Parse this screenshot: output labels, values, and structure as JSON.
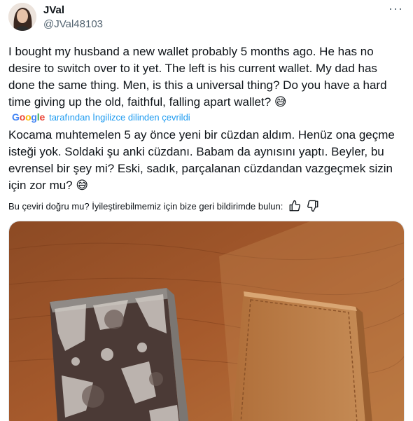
{
  "author": {
    "display_name": "JVal",
    "handle": "@JVal48103"
  },
  "icons": {
    "more": "more-horizontal-icon",
    "thumbs_up": "thumbs-up-icon",
    "thumbs_down": "thumbs-down-icon"
  },
  "more_glyph": "···",
  "tweet": {
    "text": "I bought my husband a new wallet probably 5 months ago. He has no\ndesire to switch over to it yet. The left is his current wallet. My dad has\ndone the same thing. Men, is this a universal thing? Do you have a hard\ntime giving up the old, faithful, falling apart wallet? 😅",
    "translated_by": "tarafından İngilizce dilinden çevrildi",
    "google_logo": [
      "G",
      "o",
      "o",
      "g",
      "l",
      "e"
    ],
    "translation": "Kocama muhtemelen 5 ay önce yeni bir cüzdan aldım. Henüz ona geçme\nisteği yok. Soldaki şu anki cüzdanı. Babam da aynısını yaptı. Beyler, bu\nevrensel bir şey mi? Eski, sadık, parçalanan cüzdandan vazgeçmek sizin\niçin zor mu? 😅",
    "feedback_prompt": "Bu çeviri doğru mu? İyileştirebilmemiz için bize geri bildirimde bulun:"
  },
  "colors": {
    "link": "#1d9bf0",
    "secondary_text": "#536471",
    "wood": "#a0562a",
    "new_wallet": "#b87a45",
    "old_wallet": "#4a3a35"
  }
}
